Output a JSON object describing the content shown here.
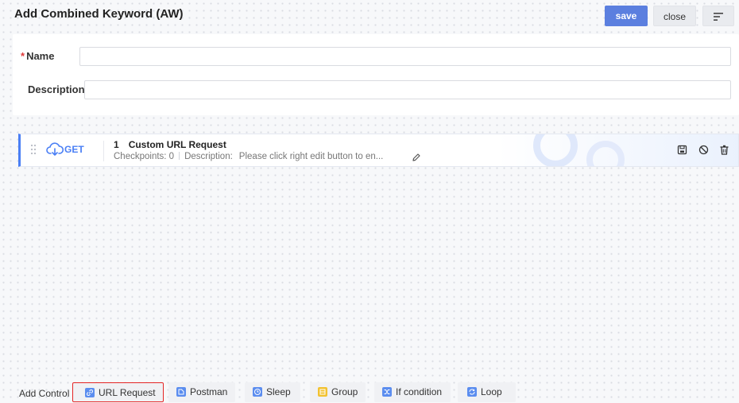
{
  "header": {
    "title": "Add Combined Keyword (AW)",
    "save_label": "save",
    "close_label": "close",
    "menu_icon": "≣"
  },
  "form": {
    "name_label": "Name",
    "name_required_mark": "*",
    "name_value": "",
    "description_label": "Description",
    "description_value": ""
  },
  "step": {
    "method": "GET",
    "number": "1",
    "title": "Custom URL Request",
    "checkpoints_text": "Checkpoints:  0",
    "description_label": "Description:",
    "description_text": "Please click right edit button to en..."
  },
  "add_control": {
    "label": "Add Control",
    "items": [
      {
        "label": "URL Request",
        "icon": "link-icon",
        "color": "#5b8def"
      },
      {
        "label": "Postman",
        "icon": "postman-icon",
        "color": "#5b8def"
      },
      {
        "label": "Sleep",
        "icon": "clock-icon",
        "color": "#5b8def"
      },
      {
        "label": "Group",
        "icon": "group-icon",
        "color": "#f2c230"
      },
      {
        "label": "If condition",
        "icon": "branch-icon",
        "color": "#5b8def"
      },
      {
        "label": "Loop",
        "icon": "loop-icon",
        "color": "#5b8def"
      }
    ]
  },
  "colors": {
    "primary": "#5b7fdf",
    "accent_blue": "#4a7ff5",
    "required": "#e03a3a",
    "selection_outline": "#e52525"
  }
}
